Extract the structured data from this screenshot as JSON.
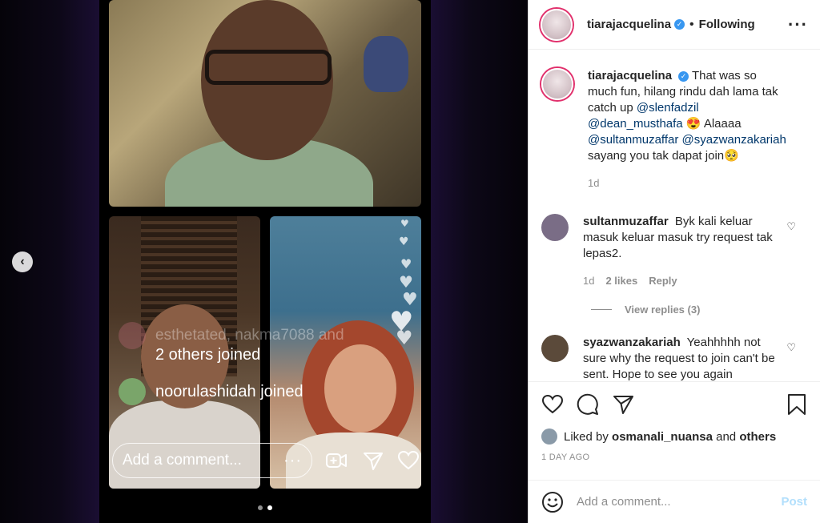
{
  "media": {
    "join_notices": {
      "faded": "esthetated, nakma7088 and",
      "others": "2 others joined",
      "noor": "noorulashidah joined"
    },
    "live_comment_placeholder": "Add a comment...",
    "more_label": "···",
    "carousel": {
      "slides": 2,
      "active_index": 1
    }
  },
  "header": {
    "username": "tiarajacquelina",
    "separator": "•",
    "follow_status": "Following",
    "more_label": "···"
  },
  "caption": {
    "username": "tiarajacquelina",
    "parts": [
      {
        "type": "text",
        "value": "That was so much fun, hilang rindu dah lama tak catch up "
      },
      {
        "type": "mention",
        "value": "@slenfadzil"
      },
      {
        "type": "text",
        "value": " "
      },
      {
        "type": "mention",
        "value": "@dean_musthafa"
      },
      {
        "type": "text",
        "value": " 😍 Alaaaa "
      },
      {
        "type": "mention",
        "value": "@sultanmuzaffar"
      },
      {
        "type": "text",
        "value": " "
      },
      {
        "type": "mention",
        "value": "@syazwanzakariah"
      },
      {
        "type": "text",
        "value": " sayang you tak dapat join🥺"
      }
    ],
    "time": "1d"
  },
  "comments": [
    {
      "username": "sultanmuzaffar",
      "text": "Byk kali keluar masuk keluar masuk try request tak lepas2.",
      "time": "1d",
      "likes": "2 likes",
      "reply_label": "Reply",
      "view_replies": "View replies (3)"
    },
    {
      "username": "syazwanzakariah",
      "text": "Yeahhhhh not sure why the request to join can't be sent. Hope to see you again"
    }
  ],
  "likes": {
    "prefix": "Liked by",
    "user": "osmanali_nuansa",
    "and": "and",
    "others": "others"
  },
  "timestamp": "1 DAY AGO",
  "add_comment": {
    "placeholder": "Add a comment...",
    "post_label": "Post"
  },
  "colors": {
    "link": "#00376b",
    "verified": "#3897f0",
    "post_disabled": "#b2dffc",
    "secondary_text": "#8e8e8e"
  },
  "icons": [
    "heart-icon",
    "comment-icon",
    "share-icon",
    "save-icon",
    "emoji-icon",
    "verified-icon",
    "chevron-left-icon"
  ]
}
